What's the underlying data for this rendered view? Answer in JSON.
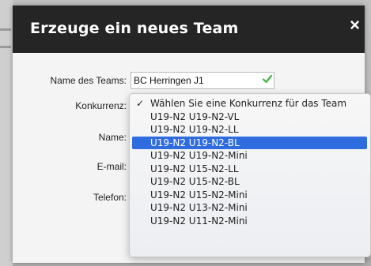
{
  "modal": {
    "title": "Erzeuge ein neues Team",
    "close_glyph": "×"
  },
  "form": {
    "team_name_label": "Name des Teams:",
    "team_name_value": "BC Herringen J1",
    "team_name_valid_icon": "check-icon",
    "konkurrenz_label": "Konkurrenz:",
    "name_label": "Name:",
    "email_label": "E-mail:",
    "telefon_label": "Telefon:"
  },
  "dropdown": {
    "checkmark": "✓",
    "options": [
      "Wählen Sie eine Konkurrenz für das Team",
      "U19-N2 U19-N2-VL",
      "U19-N2 U19-N2-LL",
      "U19-N2 U19-N2-BL",
      "U19-N2 U19-N2-Mini",
      "U19-N2 U15-N2-LL",
      "U19-N2 U15-N2-BL",
      "U19-N2 U15-N2-Mini",
      "U19-N2 U13-N2-Mini",
      "U19-N2 U11-N2-Mini"
    ],
    "checked_index": 0,
    "highlighted_index": 3
  },
  "colors": {
    "header_bg": "#252525",
    "highlight": "#2f6ce0",
    "valid_check": "#3cb43c"
  }
}
